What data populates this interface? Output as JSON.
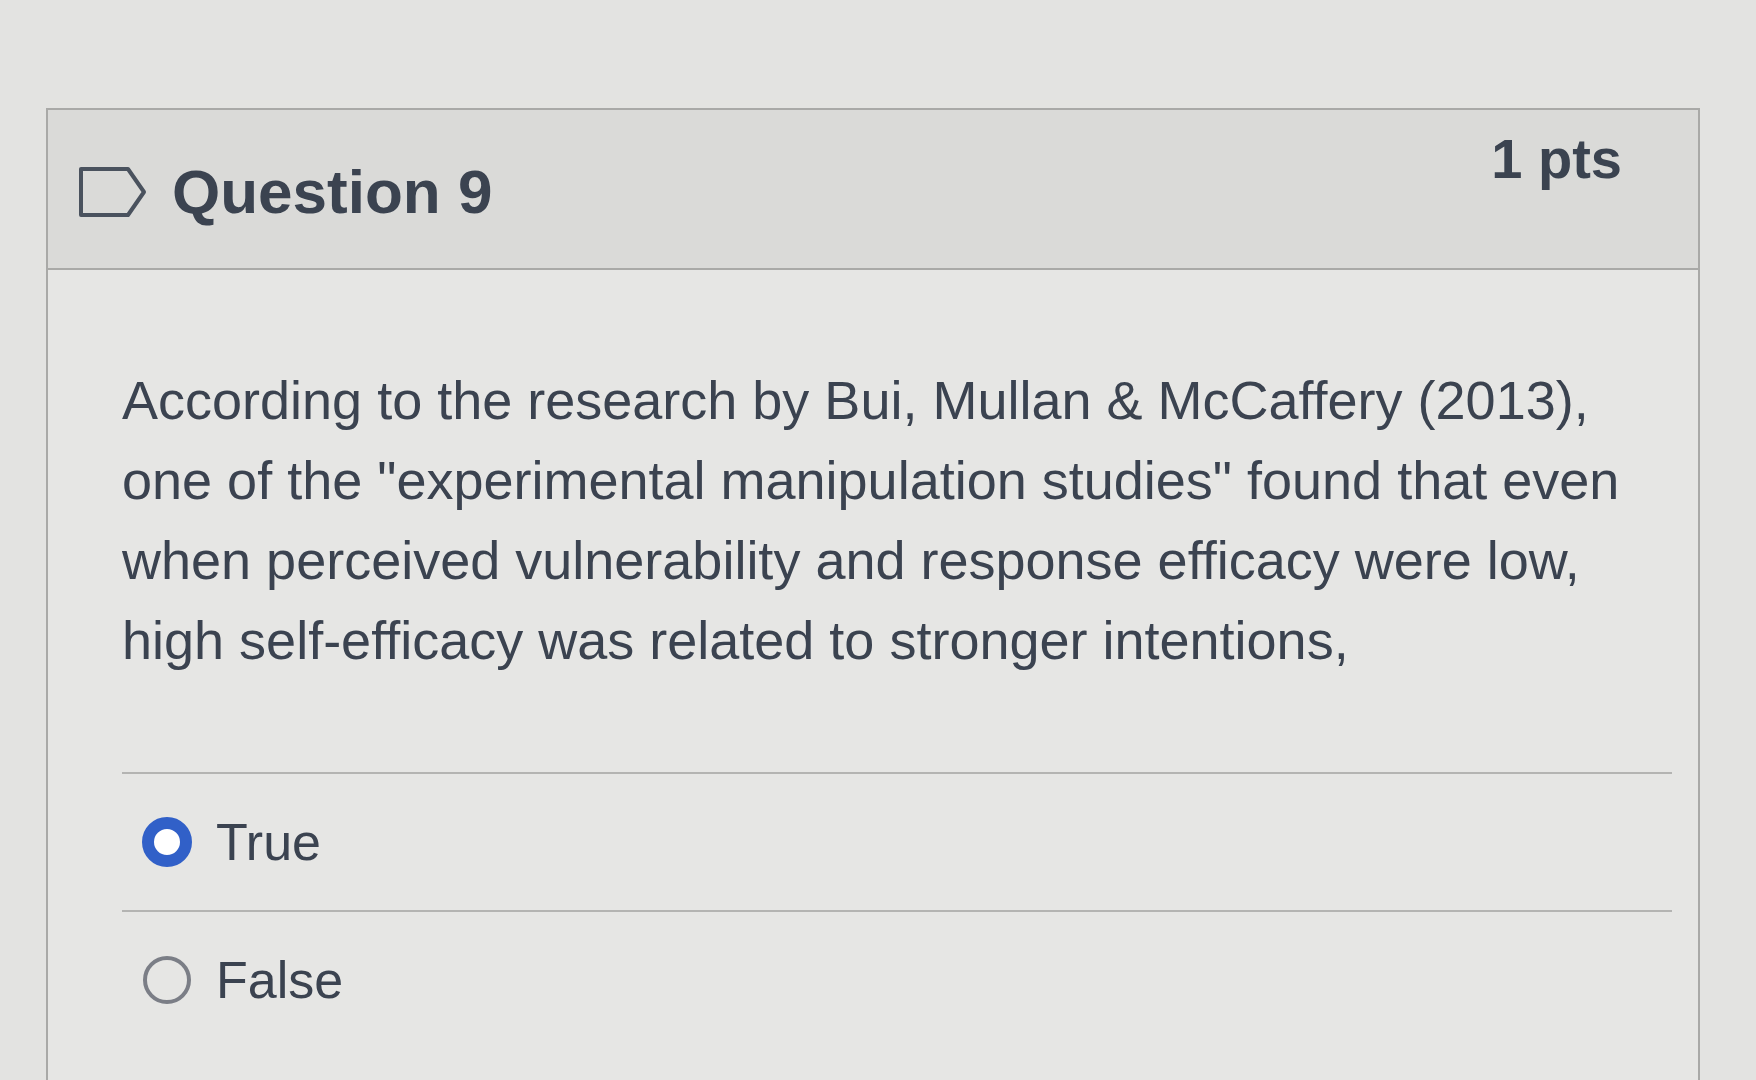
{
  "question": {
    "title": "Question 9",
    "points": "1 pts",
    "flagged": false
  },
  "prompt": "According to the research by Bui, Mullan & McCaffery (2013), one of the \"experimental manipulation studies\" found that even when perceived vulnerability and response efficacy were low, high self-efficacy was related to stronger intentions,",
  "answers": [
    {
      "label": "True",
      "selected": true
    },
    {
      "label": "False",
      "selected": false
    }
  ]
}
